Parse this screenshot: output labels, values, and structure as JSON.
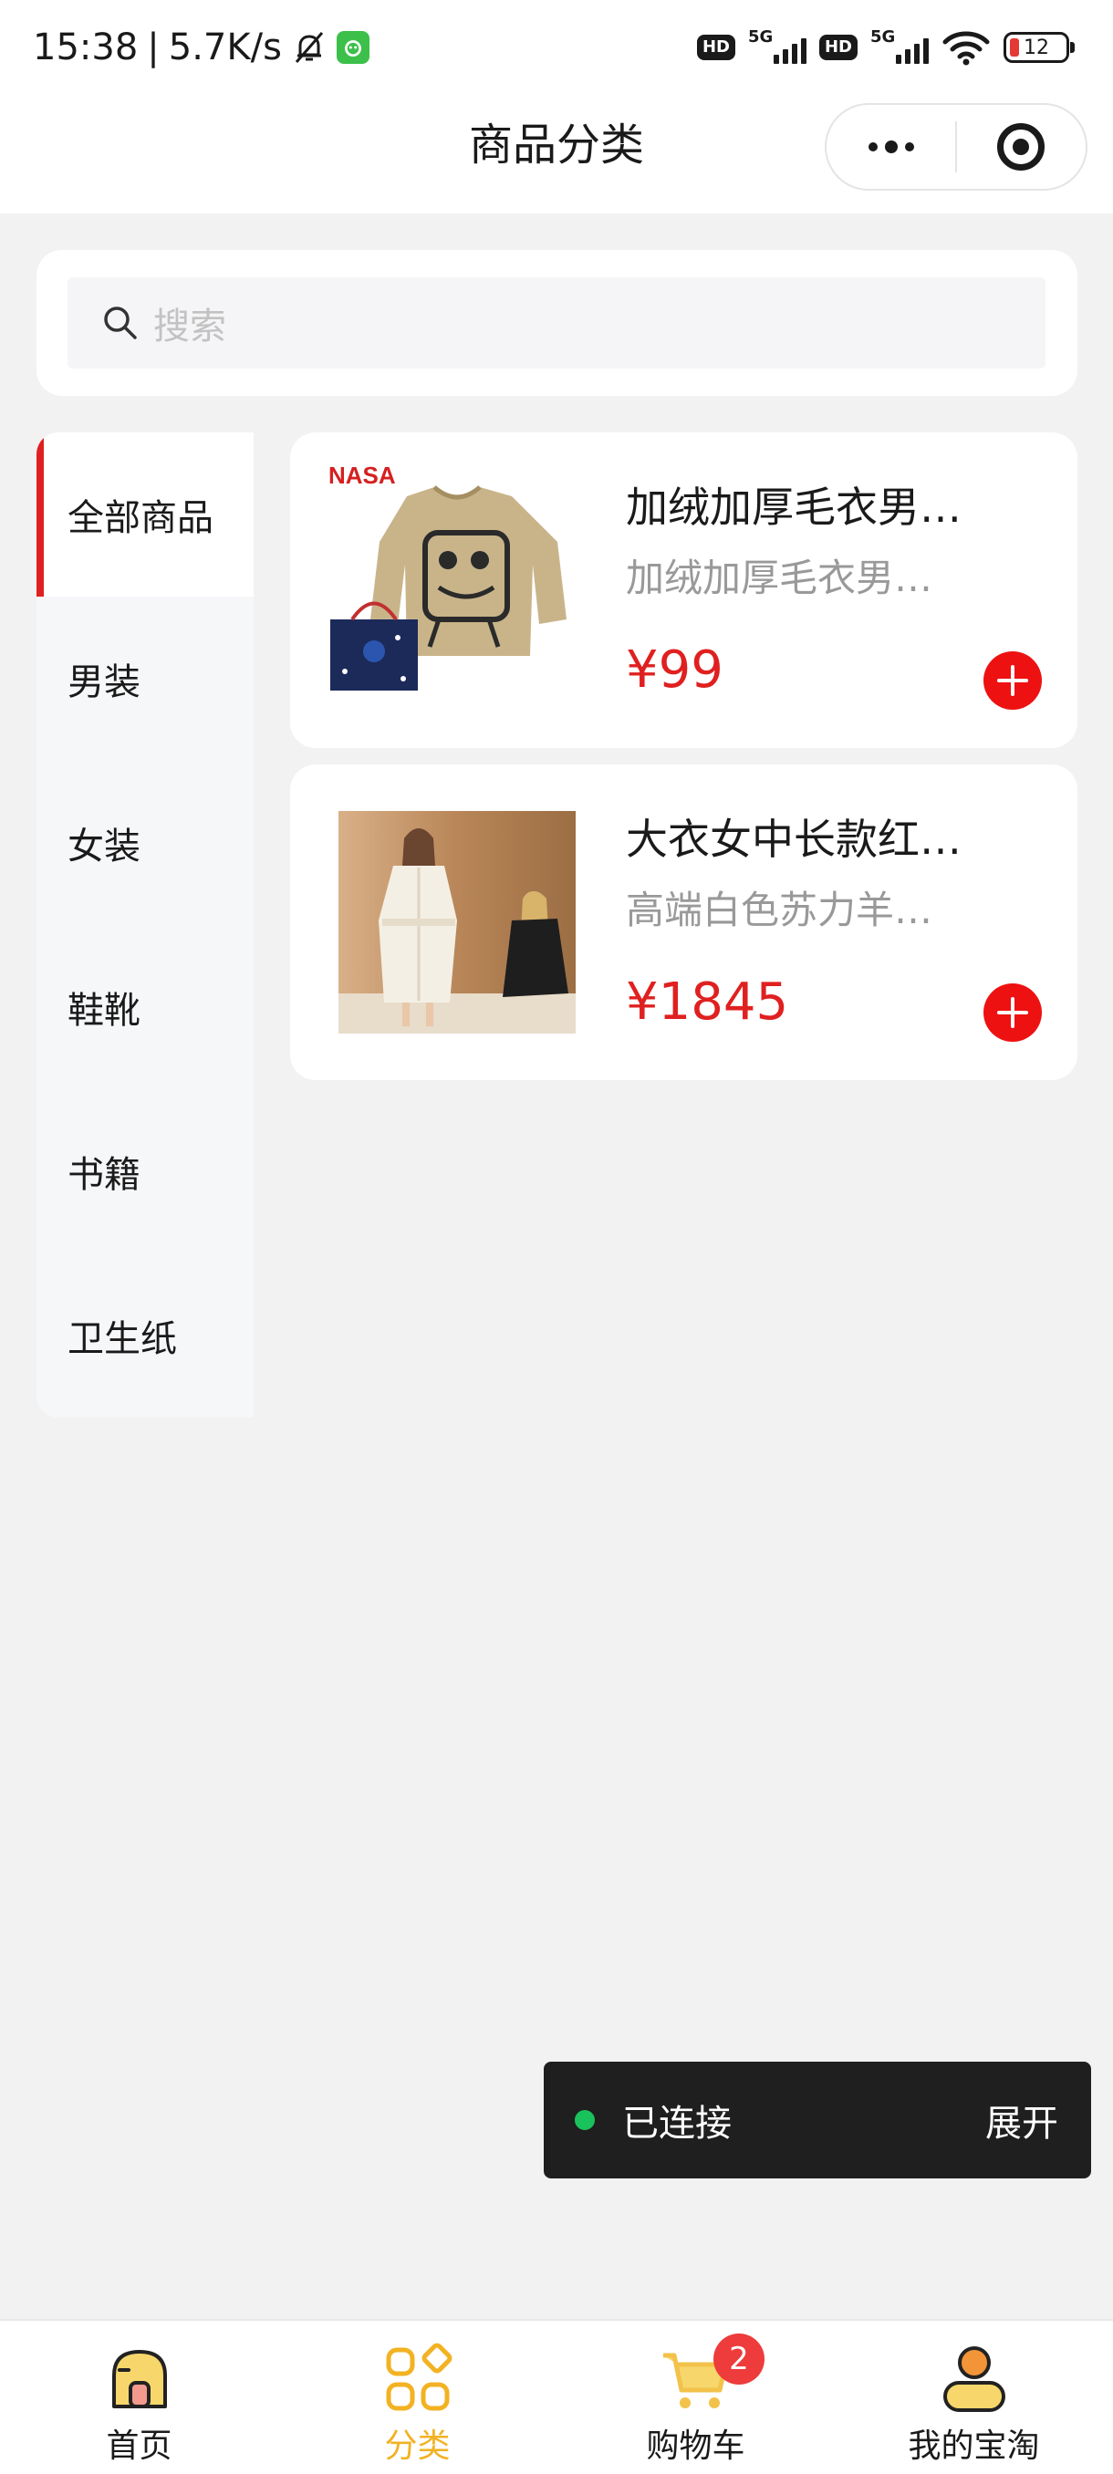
{
  "status_bar": {
    "time": "15:38",
    "separator": "|",
    "speed": "5.7K/s",
    "network_1_type": "HD",
    "network_1_gen": "5G",
    "network_2_type": "HD",
    "network_2_gen": "5G",
    "battery_level": "12",
    "battery_color": "#e53935"
  },
  "nav": {
    "title": "商品分类",
    "menu_icon": "more-dots-icon",
    "close_icon": "target-circle-icon"
  },
  "search": {
    "placeholder": "搜索",
    "icon": "search-icon"
  },
  "sidebar": {
    "active_index": 0,
    "accent_color": "#e02020",
    "items": [
      {
        "label": "全部商品"
      },
      {
        "label": "男装"
      },
      {
        "label": "女装"
      },
      {
        "label": "鞋靴"
      },
      {
        "label": "书籍"
      },
      {
        "label": "卫生纸"
      }
    ]
  },
  "products": [
    {
      "title": "加绒加厚毛衣男…",
      "desc": "加绒加厚毛衣男…",
      "price": "¥99",
      "brand_print": "NASA",
      "image": "khaki-sweater-with-cartoon-print"
    },
    {
      "title": "大衣女中长款红…",
      "desc": "高端白色苏力羊…",
      "price": "¥1845",
      "image": "model-in-white-long-coat"
    }
  ],
  "connection": {
    "status": "已连接",
    "expand_label": "展开",
    "dot_color": "#19c25b"
  },
  "tabbar": {
    "active_index": 1,
    "active_color": "#f2b222",
    "items": [
      {
        "label": "首页",
        "icon": "home-icon"
      },
      {
        "label": "分类",
        "icon": "category-grid-icon"
      },
      {
        "label": "购物车",
        "icon": "cart-icon",
        "badge": "2"
      },
      {
        "label": "我的宝淘",
        "icon": "profile-icon"
      }
    ]
  }
}
